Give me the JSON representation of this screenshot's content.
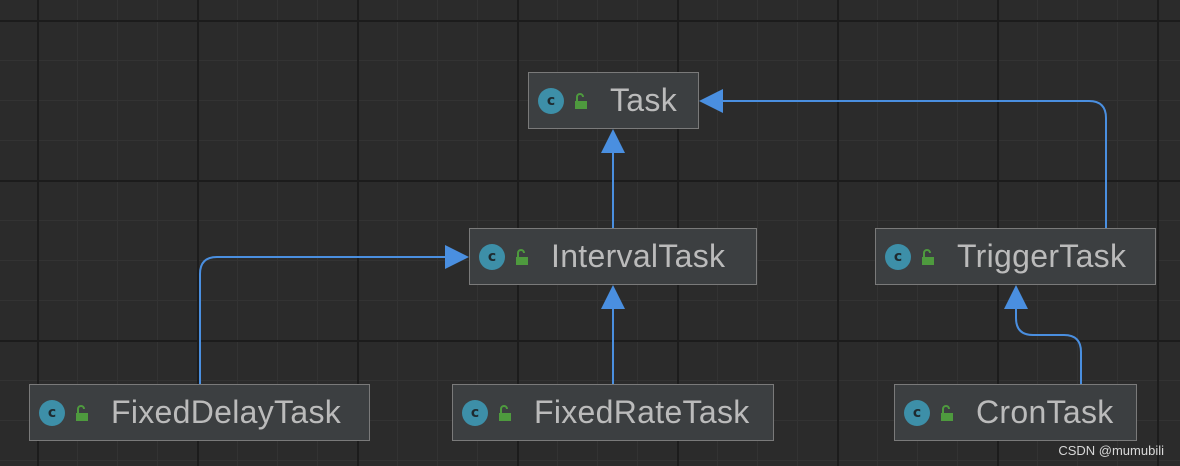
{
  "diagram": {
    "nodes": [
      {
        "id": "task",
        "label": "Task",
        "kind": "class",
        "access": "public"
      },
      {
        "id": "interval-task",
        "label": "IntervalTask",
        "kind": "class",
        "access": "public"
      },
      {
        "id": "trigger-task",
        "label": "TriggerTask",
        "kind": "class",
        "access": "public"
      },
      {
        "id": "fixed-delay-task",
        "label": "FixedDelayTask",
        "kind": "class",
        "access": "public"
      },
      {
        "id": "fixed-rate-task",
        "label": "FixedRateTask",
        "kind": "class",
        "access": "public"
      },
      {
        "id": "cron-task",
        "label": "CronTask",
        "kind": "class",
        "access": "public"
      }
    ],
    "edges": [
      {
        "from": "interval-task",
        "to": "task",
        "relation": "extends"
      },
      {
        "from": "trigger-task",
        "to": "task",
        "relation": "extends"
      },
      {
        "from": "fixed-delay-task",
        "to": "interval-task",
        "relation": "extends"
      },
      {
        "from": "fixed-rate-task",
        "to": "interval-task",
        "relation": "extends"
      },
      {
        "from": "cron-task",
        "to": "trigger-task",
        "relation": "extends"
      }
    ],
    "class_icon_letter": "c",
    "icons": {
      "class": "class-icon",
      "access": "unlocked-lock-icon"
    },
    "colors": {
      "background": "#2b2b2b",
      "node_fill": "#3c3f41",
      "node_border": "#7a7a7a",
      "node_text": "#bbbbbb",
      "class_icon": "#3d8fa8",
      "lock_icon": "#4e9a3e",
      "edge": "#4a8fe0"
    }
  },
  "watermark": "CSDN @mumubili"
}
